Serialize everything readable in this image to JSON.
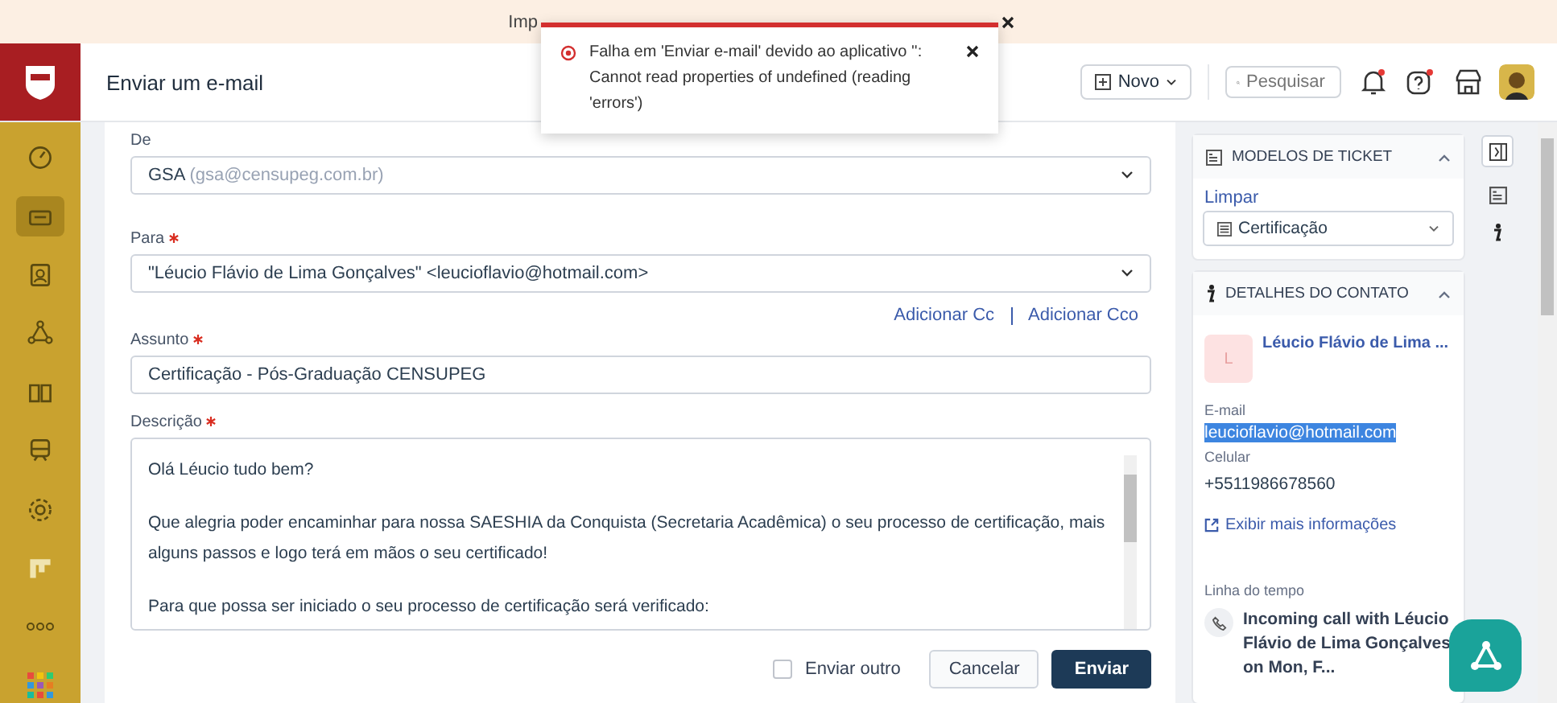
{
  "banner": {
    "text": "Imp"
  },
  "toast": {
    "message": "Falha em 'Enviar e-mail' devido ao aplicativo '': Cannot read properties of undefined (reading 'errors')"
  },
  "header": {
    "title": "Enviar um e-mail",
    "new_button": "Novo",
    "search": {
      "placeholder": "Pesquisar"
    }
  },
  "sidebar": {
    "items": [
      {
        "selected": false
      },
      {
        "selected": true
      },
      {
        "selected": false
      },
      {
        "selected": false
      },
      {
        "selected": false
      },
      {
        "selected": false
      },
      {
        "selected": false
      },
      {
        "selected": false
      },
      {
        "selected": false
      },
      {
        "selected": false
      }
    ]
  },
  "form": {
    "from": {
      "label": "De",
      "name": "GSA",
      "address": "(gsa@censupeg.com.br)"
    },
    "to": {
      "label": "Para",
      "required": true,
      "value": "\"Léucio Flávio de Lima Gonçalves\" <leucioflavio@hotmail.com>"
    },
    "links": [
      "Adicionar Cc",
      "Adicionar Cco"
    ],
    "subject": {
      "label": "Assunto",
      "required": true,
      "value": "Certificação - Pós-Graduação CENSUPEG"
    },
    "description": {
      "label": "Descrição",
      "required": true,
      "paragraphs": [
        "Olá Léucio tudo bem?",
        "Que alegria poder encaminhar para nossa SAESHIA da Conquista (Secretaria Acadêmica) o seu processo de certificação, mais alguns passos e logo terá em mãos o seu certificado!",
        "Para que possa ser iniciado o seu processo de certificação será verificado:"
      ]
    },
    "send_another": {
      "label": "Enviar outro",
      "checked": false
    },
    "cancel": "Cancelar",
    "send": "Enviar"
  },
  "templates": {
    "title": "MODELOS DE TICKET",
    "expanded": true,
    "clear": "Limpar",
    "value": "Certificação"
  },
  "contact": {
    "title": "DETALHES DO CONTATO",
    "expanded": true,
    "initial": "L",
    "name": "Léucio Flávio de Lima ...",
    "email_label": "E-mail",
    "email": "leucioflavio@hotmail.com",
    "email_highlighted": true,
    "phone_label": "Celular",
    "phone": "+5511986678560",
    "more": "Exibir mais informações",
    "timeline_label": "Linha do tempo",
    "timeline": [
      {
        "text": "Incoming call with Léucio Flávio de Lima Gonçalves on Mon, F..."
      }
    ]
  }
}
